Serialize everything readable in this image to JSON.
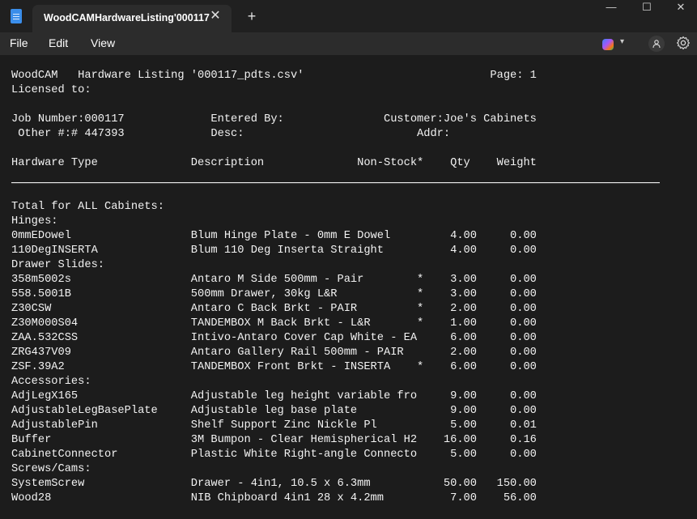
{
  "window": {
    "tab_title": "WoodCAMHardwareListing'000117",
    "tab_close": "✕",
    "new_tab": "+",
    "minimize": "—",
    "maximize": "☐",
    "close": "✕"
  },
  "menu": {
    "file": "File",
    "edit": "Edit",
    "view": "View"
  },
  "toolbar": {
    "copilot_icon": "copilot-icon",
    "account_icon": "person-icon",
    "settings_icon": "gear-icon"
  },
  "document": {
    "lines": [
      "WoodCAM   Hardware Listing '000117_pdts.csv'                            Page: 1",
      "Licensed to:",
      "",
      "Job Number:000117             Entered By:               Customer:Joe's Cabinets",
      " Other #:# 447393             Desc:                          Addr:",
      "",
      "Hardware Type              Description              Non-Stock*    Qty    Weight",
      "",
      "",
      "Total for ALL Cabinets:",
      "Hinges:",
      "0mmEDowel                  Blum Hinge Plate - 0mm E Dowel         4.00     0.00",
      "110DegINSERTA              Blum 110 Deg Inserta Straight          4.00     0.00",
      "Drawer Slides:",
      "358m5002s                  Antaro M Side 500mm - Pair        *    3.00     0.00",
      "558.5001B                  500mm Drawer, 30kg L&R            *    3.00     0.00",
      "Z30CSW                     Antaro C Back Brkt - PAIR         *    2.00     0.00",
      "Z30M000S04                 TANDEMBOX M Back Brkt - L&R       *    1.00     0.00",
      "ZAA.532CSS                 Intivo-Antaro Cover Cap White - EA     6.00     0.00",
      "ZRG437V09                  Antaro Gallery Rail 500mm - PAIR       2.00     0.00",
      "ZSF.39A2                   TANDEMBOX Front Brkt - INSERTA    *    6.00     0.00",
      "Accessories:",
      "AdjLegX165                 Adjustable leg height variable fro     9.00     0.00",
      "AdjustableLegBasePlate     Adjustable leg base plate              9.00     0.00",
      "AdjustablePin              Shelf Support Zinc Nickle Pl           5.00     0.01",
      "Buffer                     3M Bumpon - Clear Hemispherical H2    16.00     0.16",
      "CabinetConnector           Plastic White Right-angle Connecto     5.00     0.00",
      "Screws/Cams:",
      "SystemScrew                Drawer - 4in1, 10.5 x 6.3mm           50.00   150.00",
      "Wood28                     NIB Chipboard 4in1 28 x 4.2mm          7.00    56.00"
    ]
  }
}
